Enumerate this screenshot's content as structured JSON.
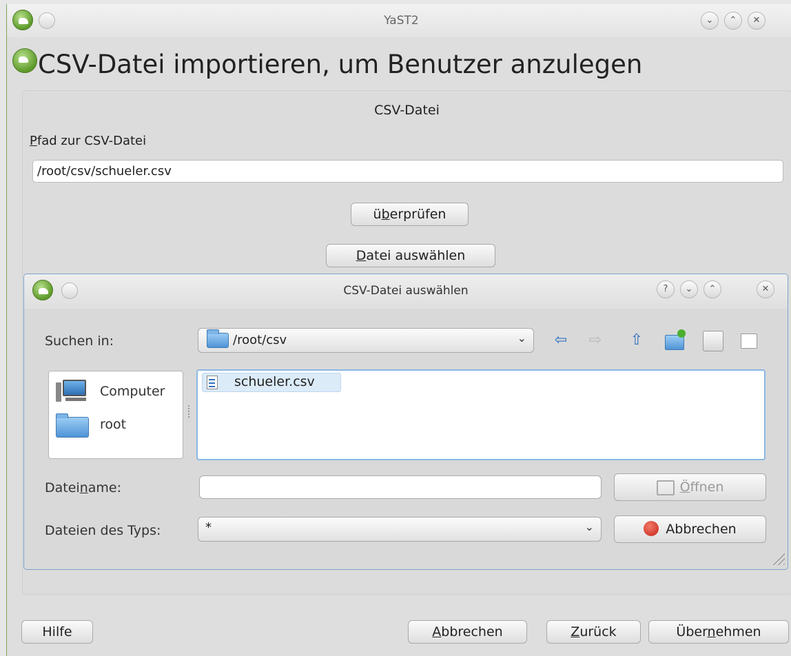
{
  "window": {
    "title": "YaST2"
  },
  "heading": "CSV-Datei importieren, um Benutzer anzulegen",
  "csv_frame": {
    "title": "CSV-Datei",
    "path_label_first": "P",
    "path_label_rest": "fad zur CSV-Datei",
    "path_value": "/root/csv/schueler.csv",
    "check_btn": {
      "pre": "ü",
      "u": "b",
      "post": "erprüfen"
    },
    "choose_btn": {
      "u": "D",
      "post": "atei auswählen"
    }
  },
  "dialog": {
    "title": "CSV-Datei auswählen",
    "help": "?",
    "look_in_label": "Suchen in:",
    "look_in_value": "/root/csv",
    "places": [
      {
        "label": "Computer",
        "icon": "computer-icon"
      },
      {
        "label": "root",
        "icon": "folder-icon"
      }
    ],
    "files": [
      {
        "name": "schueler.csv",
        "icon": "text-file-icon"
      }
    ],
    "filename_label": {
      "pre": "Datei",
      "u": "n",
      "post": "ame:"
    },
    "filename_value": "",
    "filetype_label": "Dateien des Typs:",
    "filetype_value": "*",
    "open_btn": {
      "u": "Ö",
      "post": "ffnen"
    },
    "cancel_btn": "Abbrechen"
  },
  "footer": {
    "help": "Hilfe",
    "cancel": {
      "u": "A",
      "post": "bbrechen"
    },
    "back": {
      "u": "Z",
      "post": "urück"
    },
    "accept": {
      "pre": "Über",
      "u": "n",
      "post": "ehmen"
    }
  },
  "colors": {
    "accent": "#2f6fc0",
    "green": "#5d9a2a",
    "cancel_red": "#d83a2c"
  }
}
